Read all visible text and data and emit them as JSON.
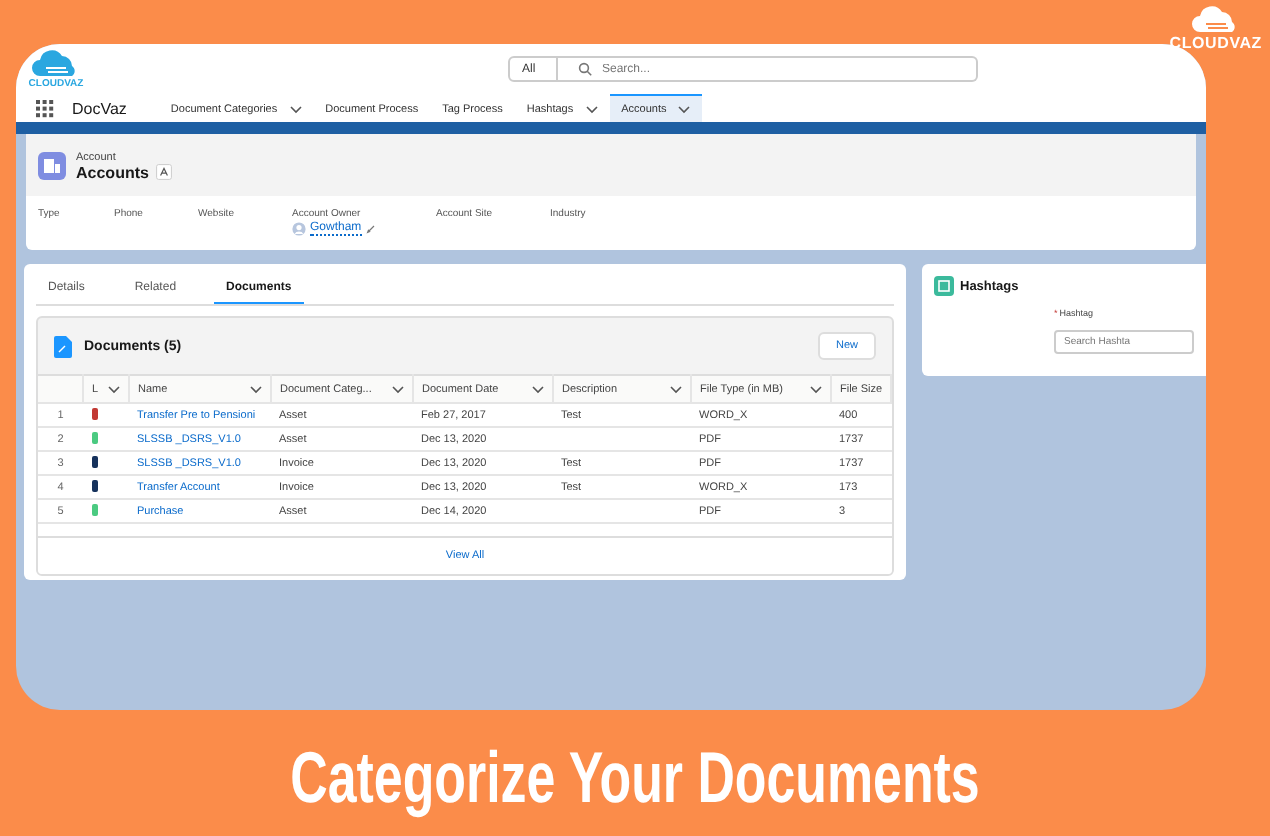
{
  "brand": "CLOUDVAZ",
  "app": {
    "logo_text": "CLOUDVAZ",
    "search_scope": "All",
    "search": {
      "placeholder": "Search..."
    },
    "app_name": "DocVaz"
  },
  "nav": [
    {
      "label": "Document Categories",
      "dropdown": true,
      "selected": false
    },
    {
      "label": "Document Process",
      "dropdown": false,
      "selected": false
    },
    {
      "label": "Tag Process",
      "dropdown": false,
      "selected": false
    },
    {
      "label": "Hashtags",
      "dropdown": true,
      "selected": false
    },
    {
      "label": "Accounts",
      "dropdown": true,
      "selected": true
    }
  ],
  "record": {
    "object": "Account",
    "title": "Accounts",
    "fields": [
      {
        "label": "Type"
      },
      {
        "label": "Phone"
      },
      {
        "label": "Website"
      },
      {
        "label": "Account Owner",
        "value": "Gowtham"
      },
      {
        "label": "Account Site"
      },
      {
        "label": "Industry"
      }
    ]
  },
  "tabs": [
    {
      "label": "Details",
      "selected": false
    },
    {
      "label": "Related",
      "selected": false
    },
    {
      "label": "Documents",
      "selected": true
    }
  ],
  "documents": {
    "title": "Documents (5)",
    "new_button": "New",
    "columns": [
      "L",
      "Name",
      "Document Categ...",
      "Document Date",
      "Description",
      "File Type (in MB)",
      "File Size"
    ],
    "rows": [
      {
        "number": "1",
        "color": "#c23934",
        "name": "Transfer Pre to Pensioni",
        "category": "Asset",
        "date": "Feb 27, 2017",
        "description": "Test",
        "file_type": "WORD_X",
        "file_size": "400"
      },
      {
        "number": "2",
        "color": "#4bca81",
        "name": "SLSSB _DSRS_V1.0",
        "category": "Asset",
        "date": "Dec 13, 2020",
        "file_type": "PDF",
        "file_size": "1737"
      },
      {
        "number": "3",
        "color": "#16325c",
        "name": "SLSSB _DSRS_V1.0",
        "category": "Invoice",
        "date": "Dec 13, 2020",
        "description": "Test",
        "file_type": "PDF",
        "file_size": "1737"
      },
      {
        "number": "4",
        "color": "#16325c",
        "name": "Transfer Account",
        "category": "Invoice",
        "date": "Dec 13, 2020",
        "description": "Test",
        "file_type": "WORD_X",
        "file_size": "173"
      },
      {
        "number": "5",
        "color": "#4bca81",
        "name": "Purchase",
        "category": "Asset",
        "date": "Dec 14, 2020",
        "file_type": "PDF",
        "file_size": "3"
      }
    ],
    "view_all": "View All"
  },
  "hashtags": {
    "title": "Hashtags",
    "field_label": "Hashtag",
    "required_mark": "*",
    "placeholder": "Search Hashta"
  },
  "headline": "Categorize Your Documents"
}
